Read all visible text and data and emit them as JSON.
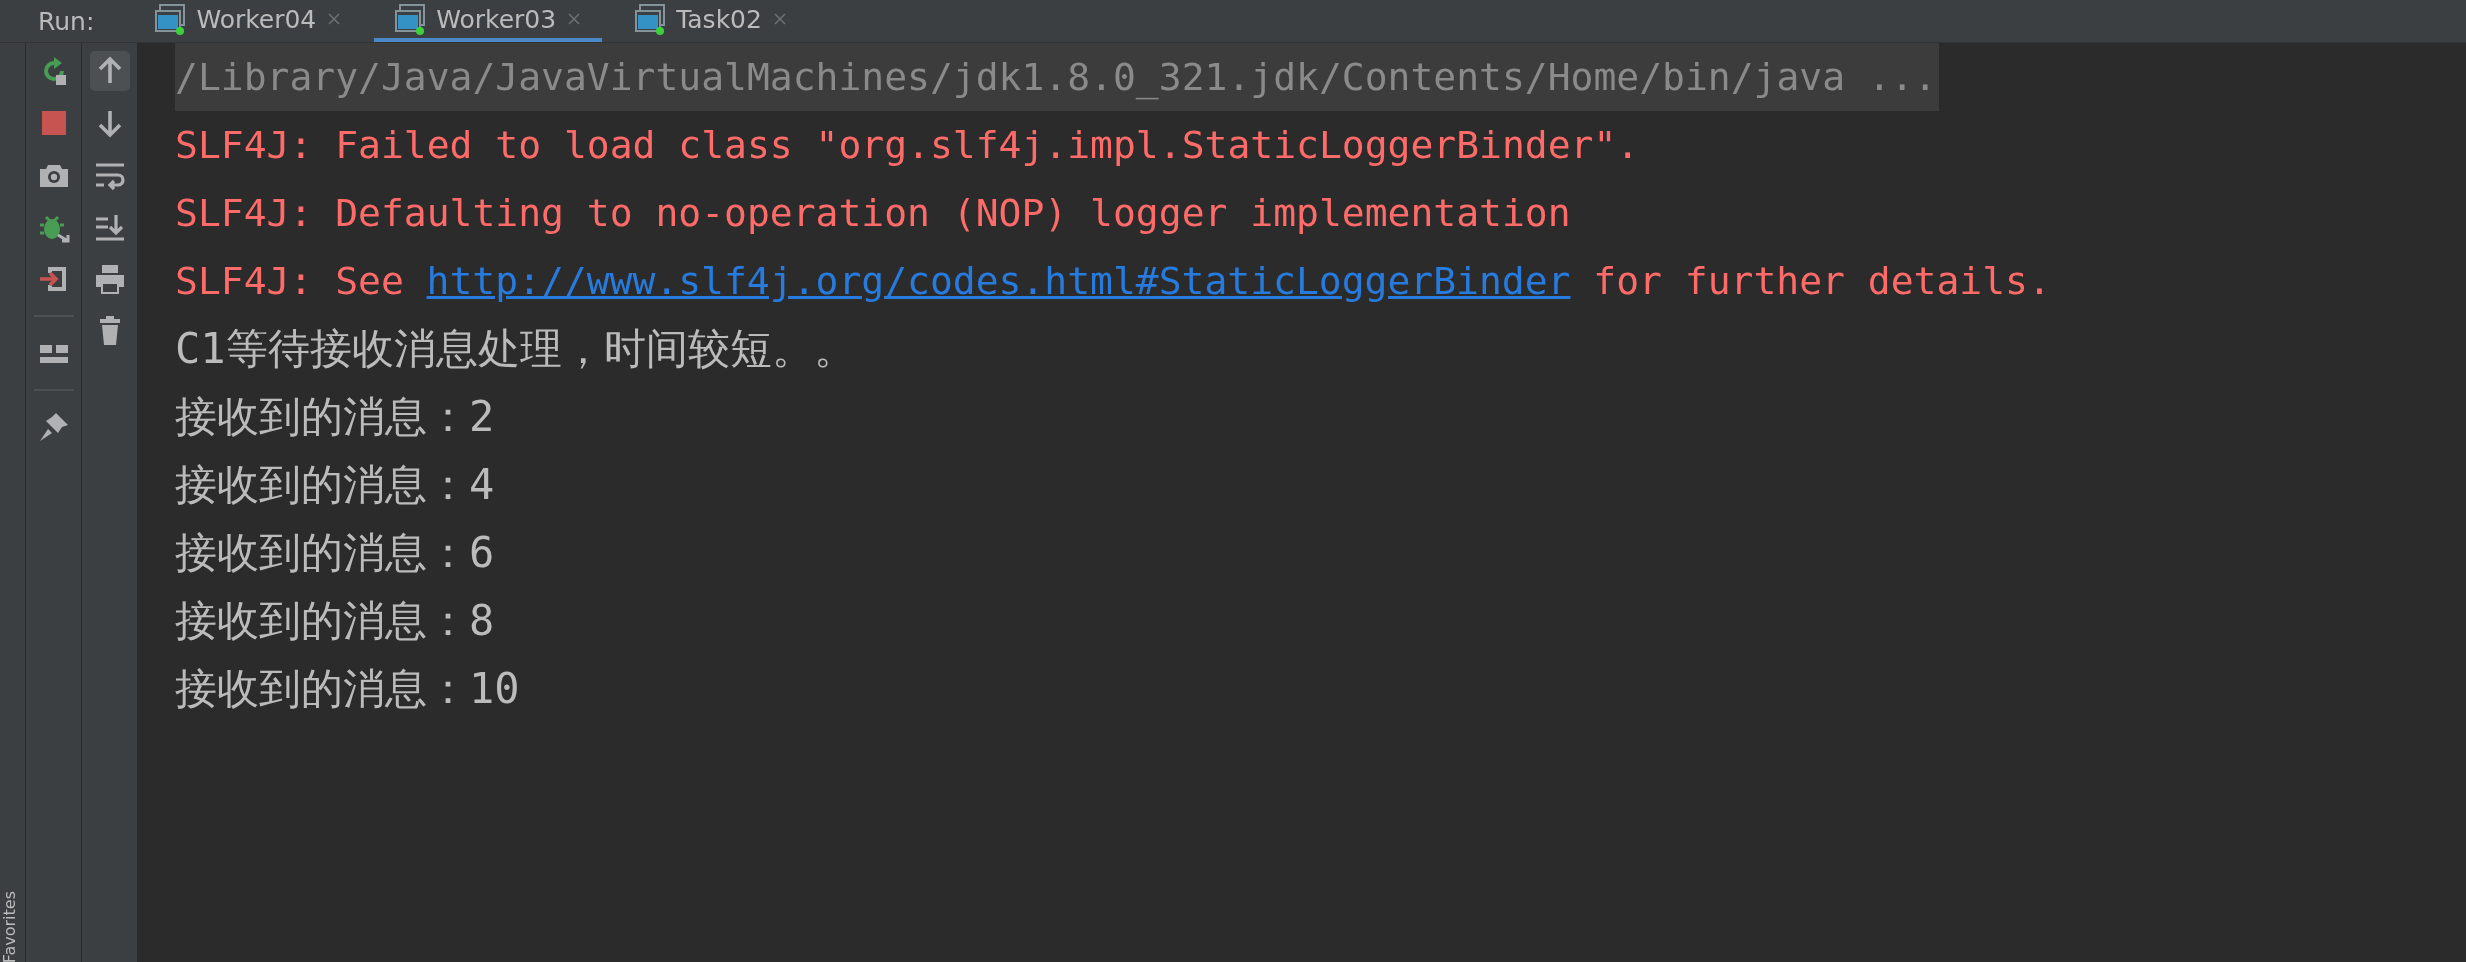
{
  "tool_window": {
    "label": "Run:"
  },
  "tabs": [
    {
      "label": "Worker04",
      "selected": false
    },
    {
      "label": "Worker03",
      "selected": true
    },
    {
      "label": "Task02",
      "selected": false
    }
  ],
  "side_strip": {
    "label": "Favorites"
  },
  "console": {
    "lines": [
      {
        "kind": "command",
        "parts": [
          {
            "kind": "text",
            "text": "/Library/Java/JavaVirtualMachines/jdk1.8.0_321.jdk/Contents/Home/bin/java ..."
          }
        ]
      },
      {
        "kind": "error",
        "parts": [
          {
            "kind": "text",
            "text": "SLF4J: Failed to load class \"org.slf4j.impl.StaticLoggerBinder\"."
          }
        ]
      },
      {
        "kind": "error",
        "parts": [
          {
            "kind": "text",
            "text": "SLF4J: Defaulting to no-operation (NOP) logger implementation"
          }
        ]
      },
      {
        "kind": "error",
        "parts": [
          {
            "kind": "text",
            "text": "SLF4J: See"
          },
          {
            "kind": "link",
            "text": "http://www.slf4j.org/codes.html#StaticLoggerBinder"
          },
          {
            "kind": "text",
            "text": "for further details."
          }
        ]
      },
      {
        "kind": "output",
        "parts": [
          {
            "kind": "text",
            "text": "C1等待接收消息处理，时间较短。。"
          }
        ]
      },
      {
        "kind": "output",
        "parts": [
          {
            "kind": "text",
            "text": "接收到的消息：2"
          }
        ]
      },
      {
        "kind": "output",
        "parts": [
          {
            "kind": "text",
            "text": "接收到的消息：4"
          }
        ]
      },
      {
        "kind": "output",
        "parts": [
          {
            "kind": "text",
            "text": "接收到的消息：6"
          }
        ]
      },
      {
        "kind": "output",
        "parts": [
          {
            "kind": "text",
            "text": "接收到的消息：8"
          }
        ]
      },
      {
        "kind": "output",
        "parts": [
          {
            "kind": "text",
            "text": "接收到的消息：10"
          }
        ]
      }
    ]
  }
}
